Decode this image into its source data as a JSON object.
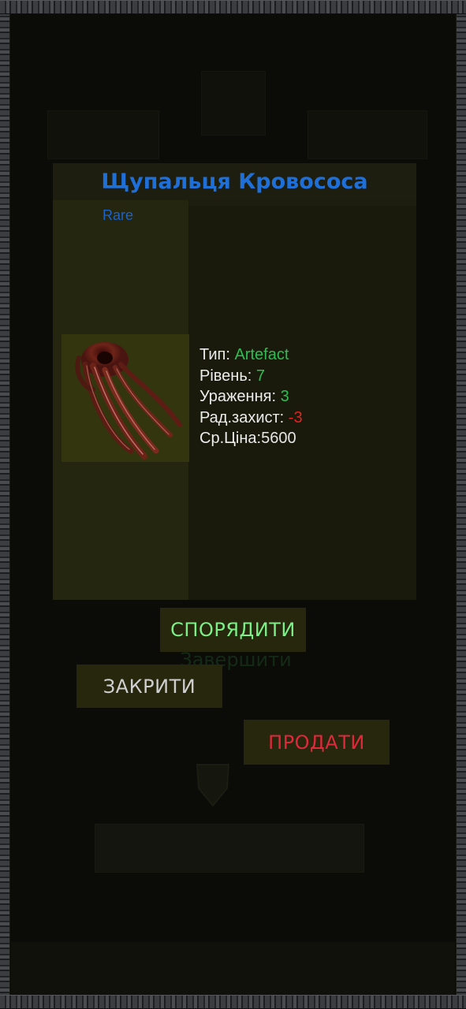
{
  "item": {
    "name": "Щупальця Кровососа",
    "rarity": "Rare",
    "image_icon": "bloodsucker-tentacles-icon"
  },
  "stats": [
    {
      "label": "Тип",
      "separator": ": ",
      "value": "Artefact",
      "color": "#2ebd52"
    },
    {
      "label": "Рівень",
      "separator": ": ",
      "value": "7",
      "color": "#2ebd52"
    },
    {
      "label": "Ураження",
      "separator": ": ",
      "value": "3",
      "color": "#2ebd52"
    },
    {
      "label": "Рад.захист",
      "separator": ": ",
      "value": "-3",
      "color": "#e12424"
    },
    {
      "label": "Ср.Ціна",
      "separator": ":",
      "value": "5600",
      "color": "#e6e6e6"
    }
  ],
  "buttons": {
    "equip": "СПОРЯДИТИ",
    "close": "ЗАКРИТИ",
    "sell": "ПРОДАТИ",
    "background_hidden": "Завершити"
  },
  "colors": {
    "title": "#1f6fd8",
    "equip": "#7dee88",
    "close": "#cfcfcf",
    "sell": "#e0283c",
    "panel": "#1d1e0f"
  }
}
